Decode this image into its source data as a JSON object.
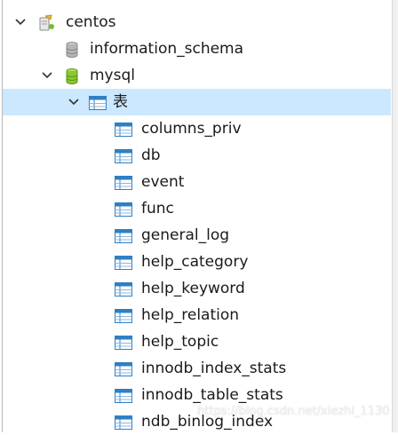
{
  "tree": {
    "connection": {
      "label": "centos",
      "icon": "connection-icon",
      "state": "expanded"
    },
    "databases": [
      {
        "label": "information_schema",
        "icon": "database-icon",
        "color": "#9a9a9a"
      },
      {
        "label": "mysql",
        "icon": "database-icon",
        "color": "#7fbf1f",
        "state": "expanded"
      }
    ],
    "tables_folder": {
      "label": "表",
      "icon": "tables-folder-icon",
      "state": "expanded",
      "selected": true
    },
    "tables": [
      "columns_priv",
      "db",
      "event",
      "func",
      "general_log",
      "help_category",
      "help_keyword",
      "help_relation",
      "help_topic",
      "innodb_index_stats",
      "innodb_table_stats",
      "ndb_binlog_index"
    ]
  },
  "watermark": "https://blog.csdn.net/xiezhi_1130",
  "colors": {
    "selection": "#cce8ff",
    "table_icon_blue": "#2f7fc4",
    "database_active": "#7fbf1f",
    "database_inactive": "#9a9a9a"
  }
}
